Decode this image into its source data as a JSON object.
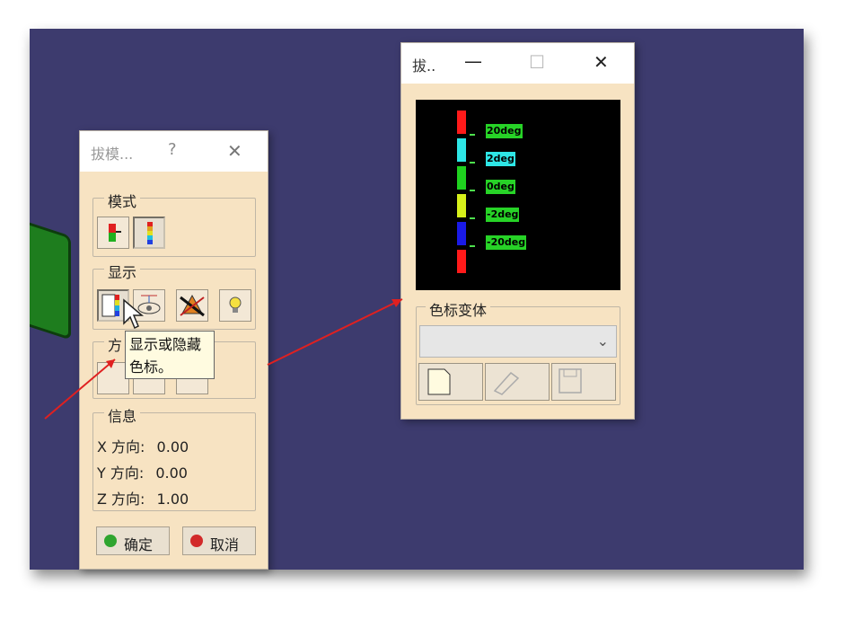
{
  "draft_dialog": {
    "title": "拔模...",
    "help": "?",
    "close": "✕",
    "mode_group": "模式",
    "display_group": "显示",
    "direction_group": "方",
    "info_group": "信息",
    "info_rows": [
      {
        "label": "X 方向:",
        "value": "0.00"
      },
      {
        "label": "Y 方向:",
        "value": "0.00"
      },
      {
        "label": "Z 方向:",
        "value": "1.00"
      }
    ],
    "ok_label": "确定",
    "cancel_label": "取消",
    "ok_color": "#2fa52f",
    "cancel_color": "#d22a2a"
  },
  "tooltip": {
    "line1": "显示或隐藏",
    "line2": "色标。"
  },
  "scale_window": {
    "title": "拔..",
    "minimize": "—",
    "maximize": "☐",
    "close": "✕",
    "variant_group": "色标变体",
    "dropdown_value": "",
    "bars": [
      {
        "color": "#ff1a1a",
        "label": "20deg",
        "label_bg": "#27d327"
      },
      {
        "color": "#2ee6e6",
        "label": "2deg",
        "label_bg": "#2ee6e6"
      },
      {
        "color": "#1fd11f",
        "label": "0deg",
        "label_bg": "#27d327"
      },
      {
        "color": "#d6f01a",
        "label": "-2deg",
        "label_bg": "#27d327"
      },
      {
        "color": "#1a1ae6",
        "label": "-20deg",
        "label_bg": "#27d327"
      },
      {
        "color": "#ff1a1a",
        "label": "",
        "label_bg": ""
      }
    ]
  },
  "icons": {
    "mode": [
      "mode-simple-icon",
      "mode-multicolor-icon"
    ],
    "display": [
      "color-scale-icon",
      "view-eye-icon",
      "crossed-shape-icon",
      "light-bulb-icon"
    ],
    "scale_buttons": [
      "new-document-icon",
      "eraser-icon",
      "save-disk-icon"
    ]
  }
}
